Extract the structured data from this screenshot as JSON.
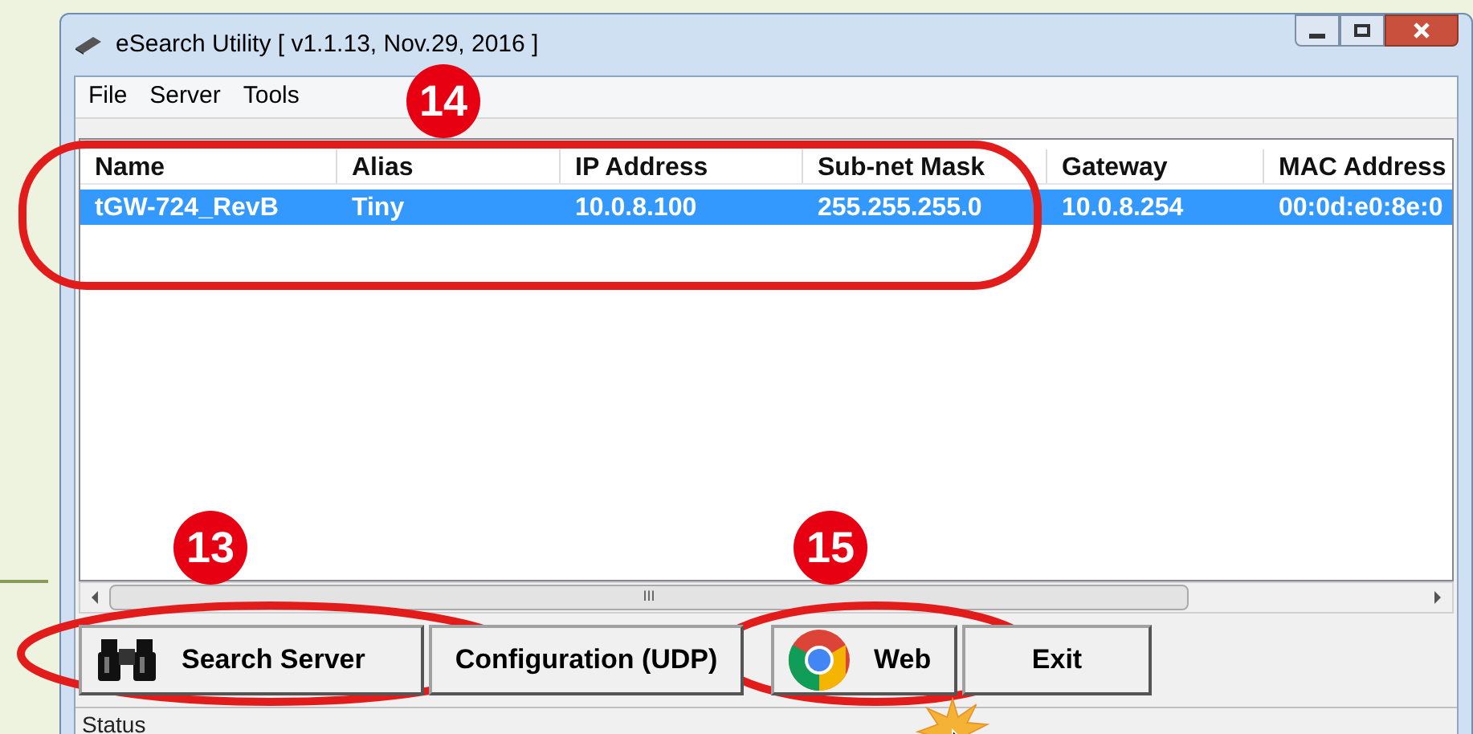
{
  "window": {
    "title": "eSearch Utility [ v1.1.13, Nov.29, 2016 ]"
  },
  "menu": [
    "File",
    "Server",
    "Tools"
  ],
  "table": {
    "columns": [
      "Name",
      "Alias",
      "IP Address",
      "Sub-net Mask",
      "Gateway",
      "MAC Address"
    ],
    "rows": [
      {
        "selected": true,
        "cells": [
          "tGW-724_RevB",
          "Tiny",
          "10.0.8.100",
          "255.255.255.0",
          "10.0.8.254",
          "00:0d:e0:8e:0"
        ]
      }
    ]
  },
  "scrollbar": {
    "grip": "III"
  },
  "buttons": [
    {
      "kind": "binoculars",
      "label": "Search Server"
    },
    {
      "kind": "plain",
      "label": "Configuration (UDP)"
    },
    {
      "kind": "browser",
      "label": "Web"
    },
    {
      "kind": "plain",
      "label": "Exit"
    }
  ],
  "status_bar": "Status",
  "annotations": [
    {
      "label": "14"
    },
    {
      "label": "13"
    },
    {
      "label": "15"
    }
  ]
}
